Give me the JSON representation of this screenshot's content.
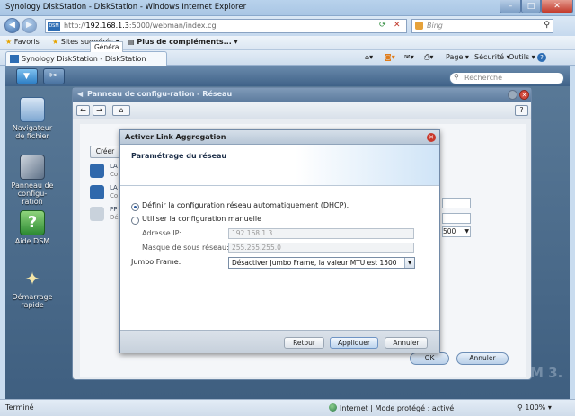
{
  "window": {
    "title": "Synology DiskStation - DiskStation - Windows Internet Explorer",
    "controls": [
      "–",
      "□",
      "✕"
    ]
  },
  "address": {
    "url_prefix": "http://",
    "url_host": "192.168.1.3",
    "url_path": ":5000/webman/index.cgi",
    "search_placeholder": "Bing"
  },
  "favorites": {
    "favoris": "Favoris",
    "suggested": "Sites suggérés ▾",
    "addons": "Plus de compléments... ▾"
  },
  "tab": {
    "label": "Synology DiskStation - DiskStation"
  },
  "toolbar_right": {
    "page": "Page ▾",
    "security": "Sécurité ▾",
    "tools": "Outils ▾",
    "help": "?"
  },
  "dsm": {
    "search_placeholder": "Recherche",
    "desktop_icons": [
      {
        "label": "Navigateur de fichier"
      },
      {
        "label": "Panneau de configu-ration"
      },
      {
        "label": "Aide DSM"
      },
      {
        "label": "Démarrage rapide"
      }
    ],
    "version_mark": "M 3.",
    "help_glyph": "?"
  },
  "panel": {
    "title": "Panneau de configu-ration - Réseau",
    "tab_general": "Généra",
    "create_btn": "Créer",
    "rows": [
      {
        "name": "LA",
        "sub": "Co"
      },
      {
        "name": "LA",
        "sub": "Co"
      },
      {
        "name": "PP",
        "sub": "Dé"
      }
    ],
    "mtu_value": "500",
    "ok": "OK",
    "cancel": "Annuler"
  },
  "dialog": {
    "title": "Activer Link Aggregation",
    "header": "Paramétrage du réseau",
    "opt_dhcp": "Définir la configuration réseau automatiquement (DHCP).",
    "opt_manual": "Utiliser la configuration manuelle",
    "ip_label": "Adresse IP:",
    "ip_value": "192.168.1.3",
    "mask_label": "Masque de sous réseau:",
    "mask_value": "255.255.255.0",
    "jumbo_label": "Jumbo Frame:",
    "jumbo_value": "Désactiver Jumbo Frame, la valeur MTU est 1500",
    "btn_back": "Retour",
    "btn_apply": "Appliquer",
    "btn_cancel": "Annuler"
  },
  "statusbar": {
    "left": "Terminé",
    "zone": "Internet | Mode protégé : activé",
    "zoom": "100%"
  }
}
